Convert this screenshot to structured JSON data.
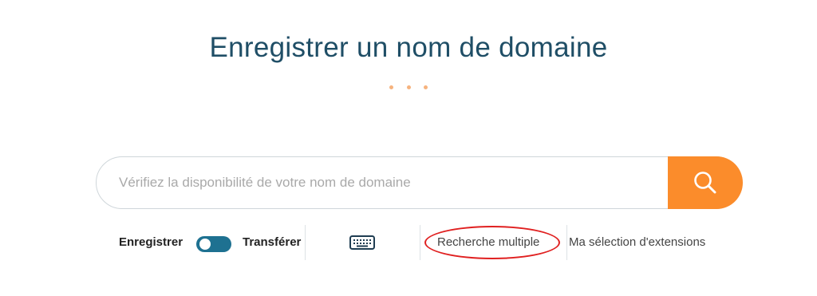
{
  "header": {
    "title": "Enregistrer un nom de domaine"
  },
  "search": {
    "placeholder": "Vérifiez la disponibilité de votre nom de domaine",
    "value": ""
  },
  "options": {
    "register_label": "Enregistrer",
    "transfer_label": "Transférer",
    "toggle_state": "register",
    "multi_search_label": "Recherche multiple",
    "extensions_label": "Ma sélection d'extensions"
  },
  "icons": {
    "search": "search-icon",
    "keyboard": "keyboard-icon"
  },
  "colors": {
    "title": "#1f4e66",
    "accent_orange": "#fb8c2b",
    "dots": "#f6b37e",
    "toggle": "#1e7191",
    "highlight": "#e02020"
  }
}
